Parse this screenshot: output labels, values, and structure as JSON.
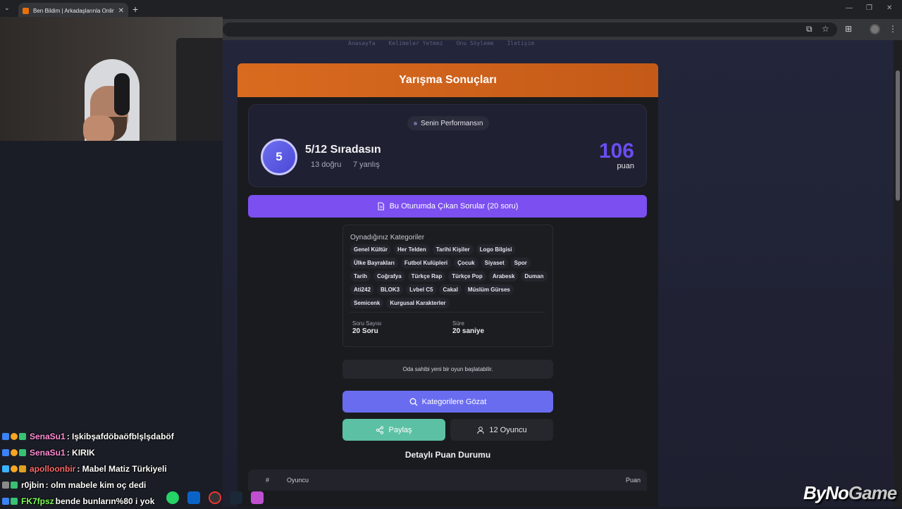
{
  "browser": {
    "tab_title": "Ben Bildim | Arkadaşlarınla Onlin",
    "new_tab": "+",
    "close": "✕"
  },
  "nav": {
    "items": [
      "Anasayfa",
      "Kelimeler Yetmez",
      "Onu Söyleme",
      "İletişim"
    ]
  },
  "results": {
    "title": "Yarışma Sonuçları",
    "perf_pill": "Senin Performansın",
    "rank": "5",
    "rank_text": "5/12 Sıradasın",
    "correct": "13 doğru",
    "wrong": "7 yanlış",
    "score": "106",
    "score_label": "puan",
    "questions_button": "Bu Oturumda Çıkan Sorular (20 soru)"
  },
  "categories": {
    "title": "Oynadığınız Kategoriler",
    "tags": [
      "Genel Kültür",
      "Her Telden",
      "Tarihi Kişiler",
      "Logo Bilgisi",
      "Ülke Bayrakları",
      "Futbol Kulüpleri",
      "Çocuk",
      "Siyaset",
      "Spor",
      "Tarih",
      "Coğrafya",
      "Türkçe Rap",
      "Türkçe Pop",
      "Arabesk",
      "Duman",
      "Ati242",
      "BLOK3",
      "Lvbel C5",
      "Cakal",
      "Müslüm Gürses",
      "Semicenk",
      "Kurgusal Karakterler"
    ],
    "question_count_label": "Soru Sayısı",
    "question_count": "20 Soru",
    "duration_label": "Süre",
    "duration": "20 saniye"
  },
  "actions": {
    "host_note": "Oda sahibi yeni bir oyun başlatabilir.",
    "browse": "Kategorilere Gözat",
    "share": "Paylaş",
    "players": "12 Oyuncu"
  },
  "scoreboard": {
    "title": "Detaylı Puan Durumu",
    "col_rank": "#",
    "col_player": "Oyuncu",
    "col_score": "Puan"
  },
  "chat": [
    {
      "user": "SenaSu1",
      "user_color": "#ff8fd6",
      "text": ": Işkibşafdöbaöfblşlşdaböf"
    },
    {
      "user": "SenaSu1",
      "user_color": "#ff8fd6",
      "text": ": KIRIK"
    },
    {
      "user": "apolloonbir",
      "user_color": "#ff6a6a",
      "text": ": Mabel Matiz Türkiyeli"
    },
    {
      "user": "r0jbin",
      "user_color": "#ffffff",
      "text": ": olm mabele kim oç dedi"
    },
    {
      "user": "FK7fpsz",
      "user_color": "#7dff5a",
      "text": "bende bunların%80 i yok"
    }
  ],
  "watermark": {
    "main": "ByNo",
    "accent": "Game"
  },
  "colors": {
    "accent_orange": "#d96b1f",
    "accent_purple": "#7b4ff0",
    "score_purple": "#6a4df2",
    "browse_blue": "#6a6cf0",
    "share_green": "#5cc0a4"
  }
}
